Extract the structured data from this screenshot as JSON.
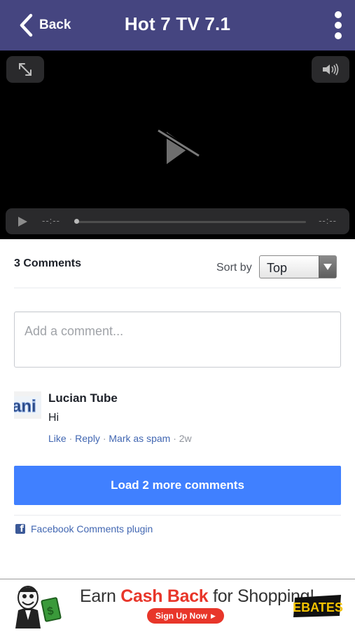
{
  "navbar": {
    "back_label": "Back",
    "title": "Hot 7 TV 7.1",
    "background": "#454580"
  },
  "player": {
    "current_time": "--:--",
    "duration": "--:--",
    "progress": 0
  },
  "comments": {
    "count_label": "3 Comments",
    "sort_label": "Sort by",
    "sort_selected": "Top",
    "input_placeholder": "Add a comment...",
    "items": [
      {
        "author": "Lucian Tube",
        "text": "Hi",
        "actions": {
          "like": "Like",
          "reply": "Reply",
          "spam": "Mark as spam",
          "separator": "·",
          "ago": "2w"
        }
      }
    ],
    "load_more_label": "Load 2 more comments",
    "plugin_label": "Facebook Comments plugin",
    "accent": "#4080ff"
  },
  "ad": {
    "headline_pre": "Earn ",
    "headline_highlight": "Cash Back",
    "headline_post": " for Shopping!",
    "cta": "Sign Up Now",
    "brand": "EBATES",
    "accent": "#e8362a"
  }
}
